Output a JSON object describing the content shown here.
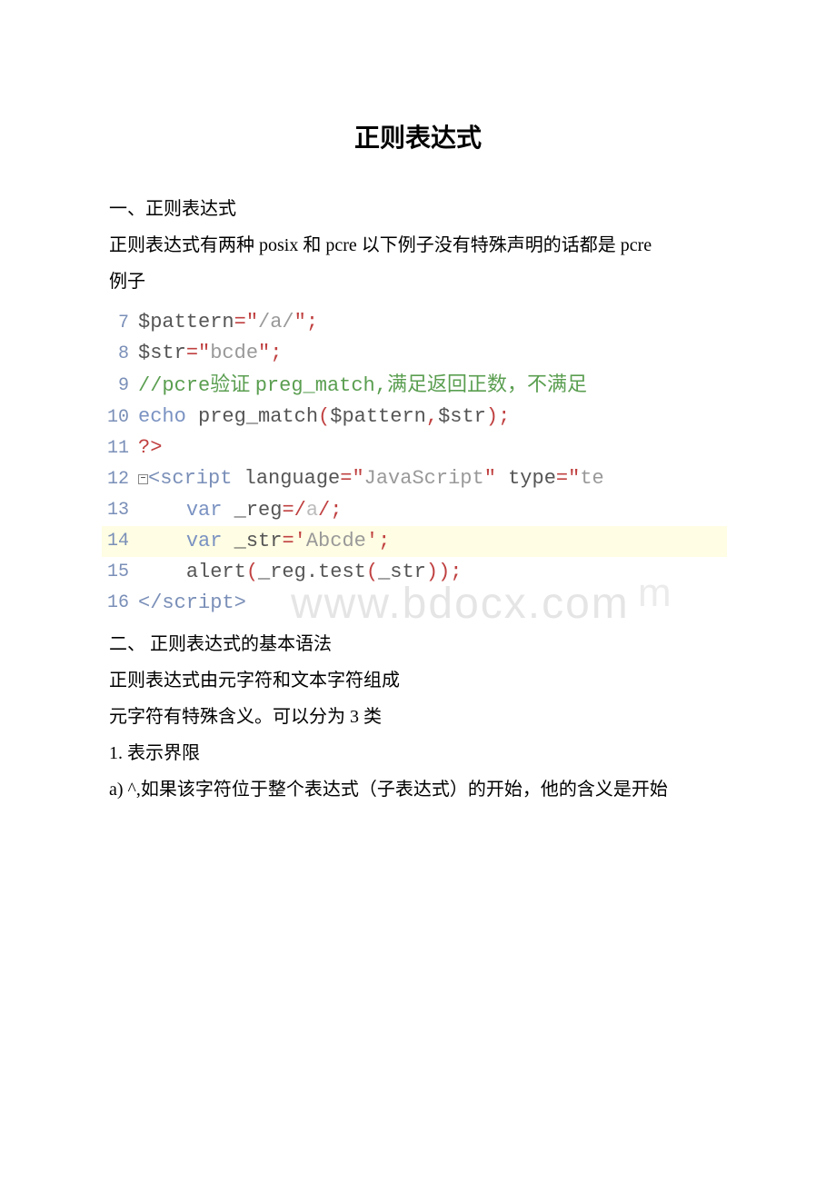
{
  "title": "正则表达式",
  "paragraphs": {
    "p1": "一、正则表达式",
    "p2": "正则表达式有两种 posix 和 pcre 以下例子没有特殊声明的话都是 pcre",
    "p3": "例子",
    "p4": "二、 正则表达式的基本语法",
    "p5": "正则表达式由元字符和文本字符组成",
    "p6": "元字符有特殊含义。可以分为 3 类",
    "p7": "1. 表示界限",
    "p8": "a) ^,如果该字符位于整个表达式（子表达式）的开始，他的含义是开始"
  },
  "lines": {
    "l7": {
      "num": "7",
      "var": "$pattern",
      "eq": "=",
      "q1": "\"",
      "s": "/a/",
      "q2": "\"",
      "semi": ";"
    },
    "l8": {
      "num": "8",
      "var": "$str",
      "eq": "=",
      "q1": "\"",
      "s": "bcde",
      "q2": "\"",
      "semi": ";"
    },
    "l9": {
      "num": "9",
      "slashes": "//",
      "en1": "pcre",
      "cn1": "验证 ",
      "en2": "preg_match,",
      "cn2": "满足返回正数，不满足"
    },
    "l10": {
      "num": "10",
      "kw": "echo ",
      "fn": "preg_match",
      "op": "(",
      "a1": "$pattern",
      "comma": ",",
      "a2": "$str",
      "cp": ")",
      "semi": ";"
    },
    "l11": {
      "num": "11",
      "tag": "?>"
    },
    "l12": {
      "num": "12",
      "lt": "<",
      "tag": "script ",
      "attr1": "language",
      "eq": "=",
      "q": "\"",
      "v1": "JavaScript",
      "q2": "\"",
      "sp": " ",
      "attr2": "type",
      "eq2": "=",
      "q3": "\"",
      "v2": "te"
    },
    "l13": {
      "num": "13",
      "indent": "    ",
      "kw": "var ",
      "name": "_reg",
      "eq": "=/",
      "val": "a",
      "rest": "/;"
    },
    "l14": {
      "num": "14",
      "indent": "    ",
      "kw": "var ",
      "name": "_str",
      "eq": "=",
      "q": "'",
      "val": "Abcde",
      "q2": "'",
      "semi": ";"
    },
    "l15": {
      "num": "15",
      "indent": "    ",
      "fn": "alert",
      "op": "(",
      "a": "_reg.test",
      "op2": "(",
      "b": "_str",
      "cp": "));"
    },
    "l16": {
      "num": "16",
      "lt": "</",
      "tag": "script",
      "gt": ">"
    }
  },
  "watermark": {
    "w1": "www.bdocx.com",
    "w2": "m"
  }
}
